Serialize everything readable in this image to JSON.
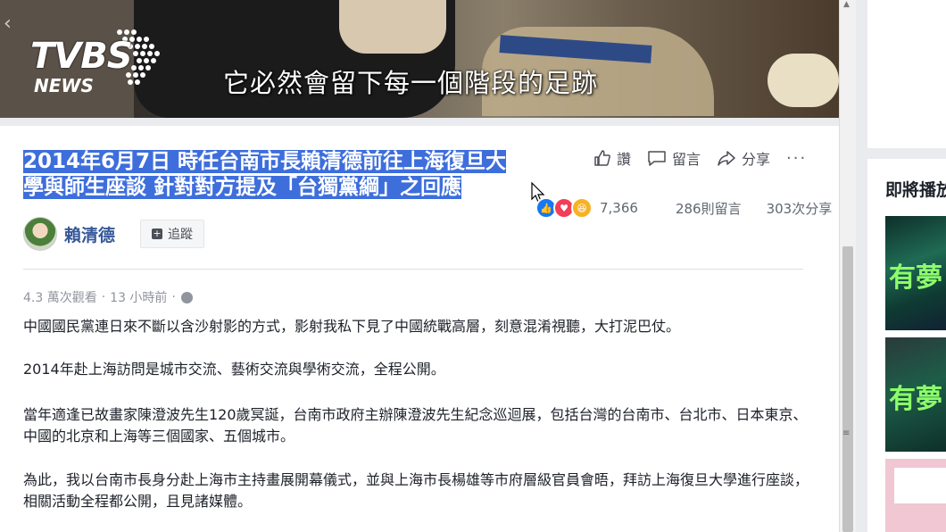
{
  "video": {
    "logo_main": "TVBS",
    "logo_sub": "NEWS",
    "subtitle": "它必然會留下每一個階段的足跡",
    "prev_arrow": "‹"
  },
  "post": {
    "headline": "2014年6月7日 時任台南市長賴清德前往上海復旦大學與師生座談 針對對方提及「台獨黨綱」之回應",
    "actions": {
      "like": "讚",
      "comment": "留言",
      "share": "分享",
      "more": "···"
    },
    "stats": {
      "reactions": "7,366",
      "comments": "286則留言",
      "shares": "303次分享"
    },
    "author": {
      "name": "賴清德",
      "follow_label": "追蹤"
    },
    "meta": {
      "views": "4.3 萬次觀看",
      "separator": "·",
      "time": "13 小時前",
      "separator2": "·"
    },
    "paragraphs": [
      "中國國民黨連日來不斷以含沙射影的方式，影射我私下見了中國統戰高層，刻意混淆視聽，大打泥巴仗。",
      "2014年赴上海訪問是城市交流、藝術交流與學術交流，全程公開。",
      "當年適逢已故畫家陳澄波先生120歲冥誕，台南市政府主辦陳澄波先生紀念巡迴展，包括台灣的台南市、台北市、日本東京、中國的北京和上海等三個國家、五個城市。",
      "為此，我以台南市長身分赴上海市主持畫展開幕儀式，並與上海市長楊雄等市府層級官員會晤，拜訪上海復旦大學進行座談，相關活動全程都公開，且見諸媒體。"
    ]
  },
  "sidebar": {
    "up_next": "即將播放",
    "thumb_caption": "有夢"
  },
  "colors": {
    "selection": "#3d6edc",
    "link": "#365899",
    "like": "#1877f2",
    "love": "#f33e58",
    "haha": "#f7b125"
  }
}
